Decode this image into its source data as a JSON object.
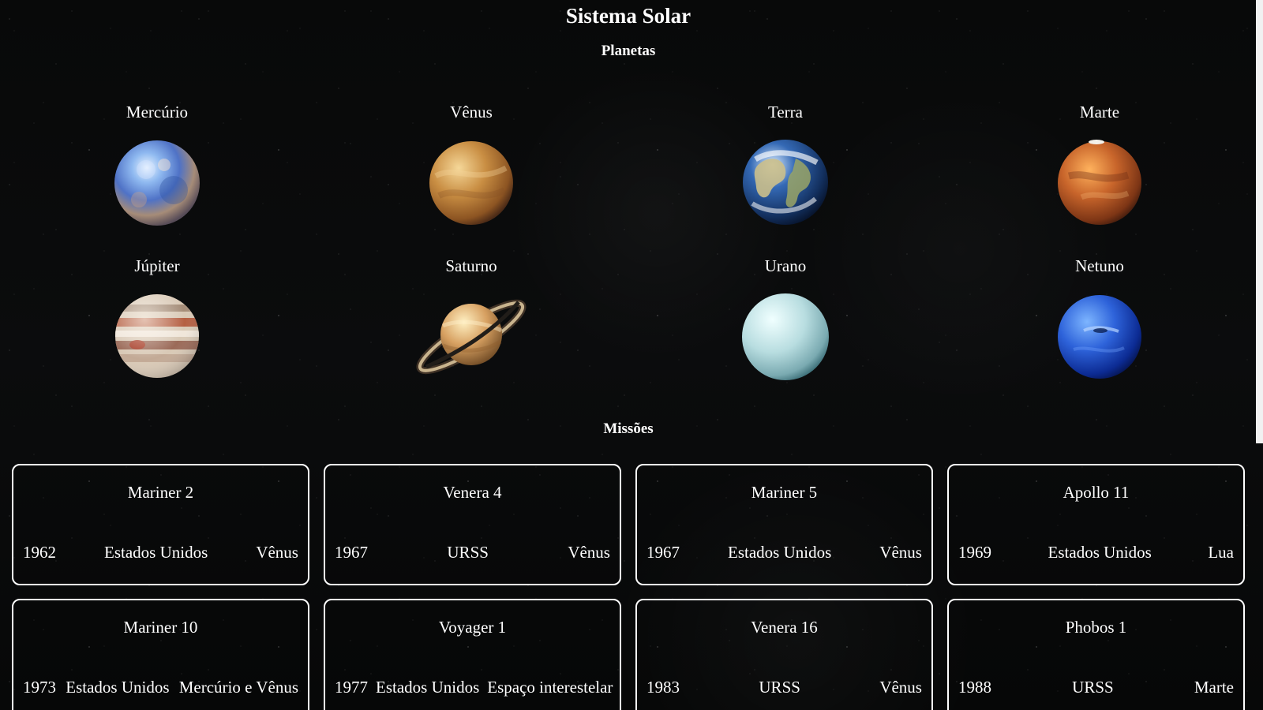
{
  "page": {
    "title": "Sistema Solar",
    "planets_heading": "Planetas",
    "missions_heading": "Missões"
  },
  "planets": [
    {
      "name": "Mercúrio",
      "icon": "mercury-icon"
    },
    {
      "name": "Vênus",
      "icon": "venus-icon"
    },
    {
      "name": "Terra",
      "icon": "earth-icon"
    },
    {
      "name": "Marte",
      "icon": "mars-icon"
    },
    {
      "name": "Júpiter",
      "icon": "jupiter-icon"
    },
    {
      "name": "Saturno",
      "icon": "saturn-icon"
    },
    {
      "name": "Urano",
      "icon": "uranus-icon"
    },
    {
      "name": "Netuno",
      "icon": "neptune-icon"
    }
  ],
  "missions": [
    {
      "name": "Mariner 2",
      "year": "1962",
      "country": "Estados Unidos",
      "target": "Vênus"
    },
    {
      "name": "Venera 4",
      "year": "1967",
      "country": "URSS",
      "target": "Vênus"
    },
    {
      "name": "Mariner 5",
      "year": "1967",
      "country": "Estados Unidos",
      "target": "Vênus"
    },
    {
      "name": "Apollo 11",
      "year": "1969",
      "country": "Estados Unidos",
      "target": "Lua"
    },
    {
      "name": "Mariner 10",
      "year": "1973",
      "country": "Estados Unidos",
      "target": "Mercúrio e Vênus"
    },
    {
      "name": "Voyager 1",
      "year": "1977",
      "country": "Estados Unidos",
      "target": "Espaço interestelar"
    },
    {
      "name": "Venera 16",
      "year": "1983",
      "country": "URSS",
      "target": "Vênus"
    },
    {
      "name": "Phobos 1",
      "year": "1988",
      "country": "URSS",
      "target": "Marte"
    }
  ],
  "colors": {
    "background": "#070809",
    "text": "#ffffff",
    "card_border": "#ffffff",
    "scrollbar": "#f1f1f1"
  }
}
